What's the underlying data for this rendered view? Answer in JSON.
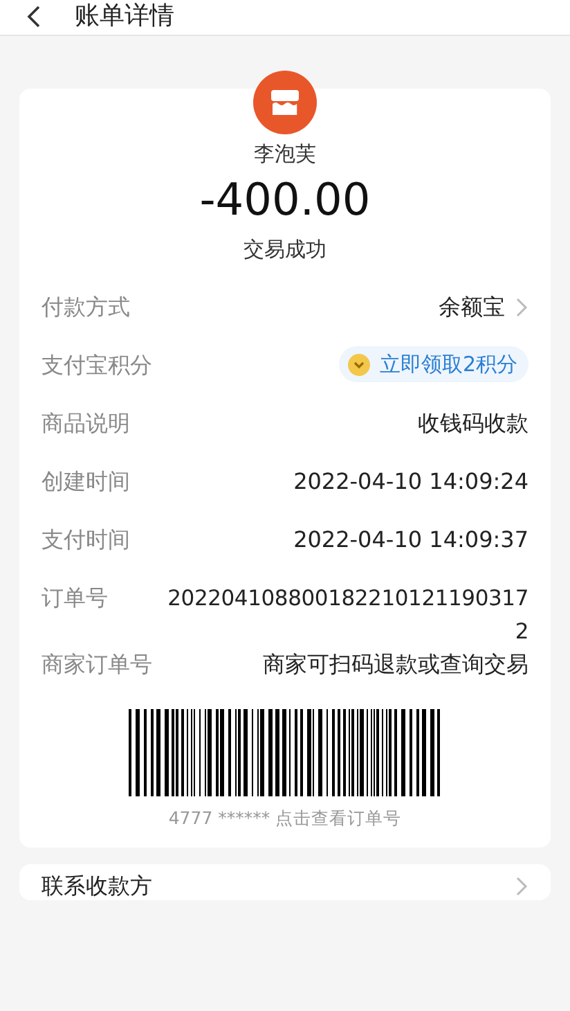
{
  "header": {
    "title": "账单详情"
  },
  "summary": {
    "merchant": "李泡芙",
    "amount": "-400.00",
    "status": "交易成功"
  },
  "rows": [
    {
      "kind": "link",
      "label": "付款方式",
      "value": "余额宝"
    },
    {
      "kind": "points",
      "label": "支付宝积分",
      "value": "立即领取2积分"
    },
    {
      "kind": "text",
      "label": "商品说明",
      "value": "收钱码收款"
    },
    {
      "kind": "text",
      "label": "创建时间",
      "value": "2022-04-10 14:09:24"
    },
    {
      "kind": "text",
      "label": "支付时间",
      "value": "2022-04-10 14:09:37"
    },
    {
      "kind": "wrap",
      "label": "订单号",
      "value": "2022041088001822101211903172"
    },
    {
      "kind": "text",
      "label": "商家订单号",
      "value": "商家可扫码退款或查询交易"
    }
  ],
  "barcode": {
    "caption": "4777 ****** 点击查看订单号"
  },
  "footer_card": {
    "label": "联系收款方"
  }
}
